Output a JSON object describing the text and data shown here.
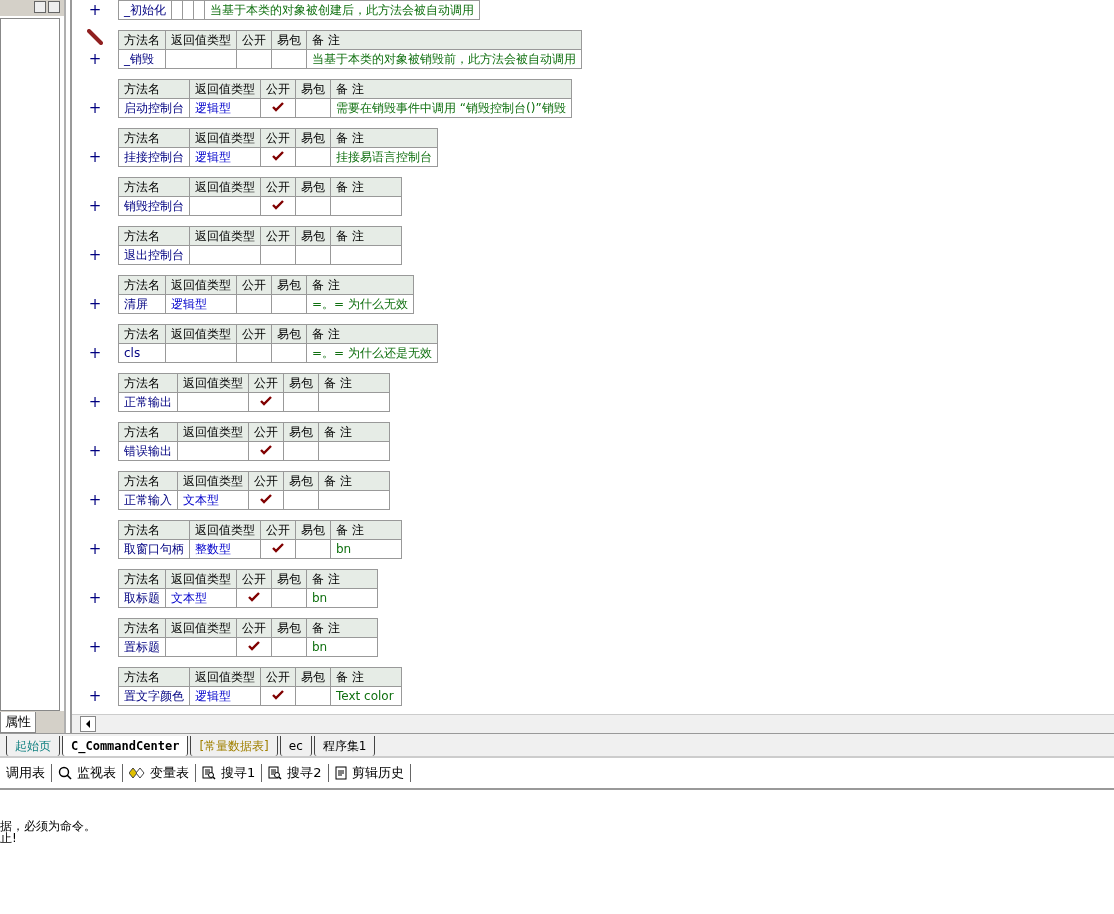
{
  "left_panel": {
    "tab": "属性"
  },
  "methods": [
    {
      "name": "_初始化",
      "public": false,
      "remark": "当基于本类的对象被创建后，此方法会被自动调用",
      "editing": false
    },
    {
      "header": [
        "方法名",
        "返回值类型",
        "公开",
        "易包",
        "备 注"
      ],
      "name": "_销毁",
      "public": false,
      "remark": "当基于本类的对象被销毁前，此方法会被自动调用",
      "editing": true
    },
    {
      "header": [
        "方法名",
        "返回值类型",
        "公开",
        "易包",
        "备 注"
      ],
      "name": "启动控制台",
      "return_type": "逻辑型",
      "public": true,
      "remark": "需要在销毁事件中调用 “销毁控制台()”销毁",
      "editing": false
    },
    {
      "header": [
        "方法名",
        "返回值类型",
        "公开",
        "易包",
        "备 注"
      ],
      "name": "挂接控制台",
      "return_type": "逻辑型",
      "public": true,
      "remark": "挂接易语言控制台",
      "editing": false
    },
    {
      "header": [
        "方法名",
        "返回值类型",
        "公开",
        "易包",
        "备 注"
      ],
      "name": "销毁控制台",
      "public": true,
      "editing": false
    },
    {
      "header": [
        "方法名",
        "返回值类型",
        "公开",
        "易包",
        "备 注"
      ],
      "name": "退出控制台",
      "public": false,
      "editing": false
    },
    {
      "header": [
        "方法名",
        "返回值类型",
        "公开",
        "易包",
        "备 注"
      ],
      "name": "清屏",
      "return_type": "逻辑型",
      "public": false,
      "remark": "=。= 为什么无效",
      "editing": false
    },
    {
      "header": [
        "方法名",
        "返回值类型",
        "公开",
        "易包",
        "备 注"
      ],
      "name": "cls",
      "public": false,
      "remark": "=。= 为什么还是无效",
      "editing": false
    },
    {
      "header": [
        "方法名",
        "返回值类型",
        "公开",
        "易包",
        "备 注"
      ],
      "name": "正常输出",
      "public": true,
      "editing": false
    },
    {
      "header": [
        "方法名",
        "返回值类型",
        "公开",
        "易包",
        "备 注"
      ],
      "name": "错误输出",
      "public": true,
      "editing": false
    },
    {
      "header": [
        "方法名",
        "返回值类型",
        "公开",
        "易包",
        "备 注"
      ],
      "name": "正常输入",
      "return_type": "文本型",
      "public": true,
      "editing": false
    },
    {
      "header": [
        "方法名",
        "返回值类型",
        "公开",
        "易包",
        "备 注"
      ],
      "name": "取窗口句柄",
      "return_type": "整数型",
      "public": true,
      "remark": "bn",
      "editing": false
    },
    {
      "header": [
        "方法名",
        "返回值类型",
        "公开",
        "易包",
        "备 注"
      ],
      "name": "取标题",
      "return_type": "文本型",
      "public": true,
      "remark": "bn",
      "editing": false
    },
    {
      "header": [
        "方法名",
        "返回值类型",
        "公开",
        "易包",
        "备 注"
      ],
      "name": "置标题",
      "public": true,
      "remark": "bn",
      "editing": false
    },
    {
      "header": [
        "方法名",
        "返回值类型",
        "公开",
        "易包",
        "备 注"
      ],
      "name": "置文字颜色",
      "return_type": "逻辑型",
      "public": true,
      "remark": "Text color",
      "editing": false
    }
  ],
  "expand_mark": "+",
  "tabs": [
    {
      "label": "起始页",
      "kind": "start",
      "selected": false
    },
    {
      "label": "C_CommandCenter",
      "kind": "class",
      "selected": true
    },
    {
      "label": "[常量数据表]",
      "kind": "const",
      "selected": false
    },
    {
      "label": "ec",
      "kind": "class",
      "selected": false
    },
    {
      "label": "程序集1",
      "kind": "module",
      "selected": false
    }
  ],
  "toolbar": [
    {
      "label": "调用表",
      "kind": "none"
    },
    {
      "label": "监视表",
      "kind": "search"
    },
    {
      "label": "变量表",
      "kind": "vars"
    },
    {
      "label": "搜寻1",
      "kind": "find"
    },
    {
      "label": "搜寻2",
      "kind": "find"
    },
    {
      "label": "剪辑历史",
      "kind": "clip"
    }
  ],
  "output": [
    "据，必须为命令。",
    "止!"
  ]
}
